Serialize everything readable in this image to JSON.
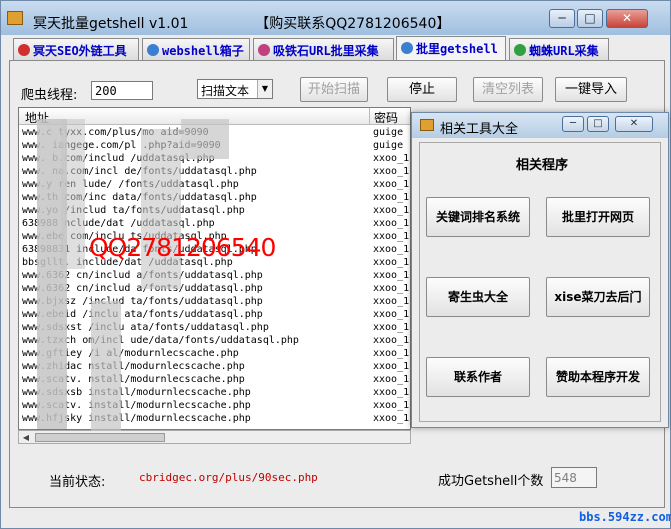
{
  "window": {
    "title": "冥天批量getshell v1.01",
    "contact": "【购买联系QQ2781206540】",
    "minimize": "─",
    "maximize": "□",
    "close": "✕"
  },
  "tabs": [
    {
      "label": "冥天SEO外链工具",
      "active": false
    },
    {
      "label": "webshell箱子",
      "active": false
    },
    {
      "label": "吸铁石URL批里采集",
      "active": false
    },
    {
      "label": "批里getshell",
      "active": true
    },
    {
      "label": "蜘蛛URL采集",
      "active": false
    }
  ],
  "controls": {
    "threads_label": "爬虫线程:",
    "threads_value": "200",
    "mode_value": "扫描文本",
    "start_scan": "开始扫描",
    "stop": "停止",
    "clear_list": "清空列表",
    "one_click_import": "一键导入"
  },
  "table": {
    "headers": [
      "地址",
      "密码"
    ],
    "rows": [
      [
        "www.c     tyxx.com/plus/mo     aid=9090",
        "guige"
      ],
      [
        "www.      iangege.com/pl      .php?aid=9090",
        "guige"
      ],
      [
        "www.     b.com/includ      /uddatasql.php",
        "xxoo_1"
      ],
      [
        "www.      na.com/incl      de/fonts/uddatasql.php",
        "xxoo_1"
      ],
      [
        "www.y     ren    lude/     /fonts/uddatasql.php",
        "xxoo_1"
      ],
      [
        "www.th      com/inc      data/fonts/uddatasql.php",
        "xxoo_1"
      ],
      [
        "www.yo      /includ      ta/fonts/uddatasql.php",
        "xxoo_1"
      ],
      [
        "638988      nclude/dat     /uddatasql.php",
        "xxoo_1"
      ],
      [
        "www.ebe     com/inclu     ts/uddatasql.php",
        "xxoo_1"
      ],
      [
        "63898831     include/da      fonts/uddatasql.php",
        "xxoo_1"
      ],
      [
        "bbsgllt.      include/dat     /uddatasql.php",
        "xxoo_1"
      ],
      [
        "www.6362     cn/includ      a/fonts/uddatasql.php",
        "xxoo_1"
      ],
      [
        "www.6362     cn/includ      a/fonts/uddatasql.php",
        "xxoo_1"
      ],
      [
        "www.bjxsz     /includ     ta/fonts/uddatasql.php",
        "xxoo_1"
      ],
      [
        "www.ebeid     /inclu     ata/fonts/uddatasql.php",
        "xxoo_1"
      ],
      [
        "www.sdsxst     /inclu     ata/fonts/uddatasql.php",
        "xxoo_1"
      ],
      [
        "www.tzxch     om/incl     ude/data/fonts/uddatasql.php",
        "xxoo_1"
      ],
      [
        "www.gftiey     /i     al/modurnlecscache.php",
        "xxoo_1"
      ],
      [
        "www.zhidac     nstall/modurnlecscache.php",
        "xxoo_1"
      ],
      [
        "www.scatv.     nstall/modurnlecscache.php",
        "xxoo_1"
      ],
      [
        "www.sdsxsb     install/modurnlecscache.php",
        "xxoo_1"
      ],
      [
        "www.scatv.     install/modurnlecscache.php",
        "xxoo_1"
      ],
      [
        "www.hfjsky     install/modurnlecscache.php",
        "xxoo_1"
      ]
    ]
  },
  "watermark_text": "QQ2781206540",
  "status": {
    "label": "当前状态:",
    "url": "cbridgec.org/plus/90sec.php",
    "count_label": "成功Getshell个数",
    "count_value": "548"
  },
  "site_mark": "bbs.594zz.com",
  "popup": {
    "title": "相关工具大全",
    "minimize": "─",
    "maximize": "□",
    "close": "✕",
    "group_title": "相关程序",
    "buttons": [
      "关键词排名系统",
      "批里打开网页",
      "寄生虫大全",
      "xise菜刀去后门",
      "联系作者",
      "赞助本程序开发"
    ]
  }
}
